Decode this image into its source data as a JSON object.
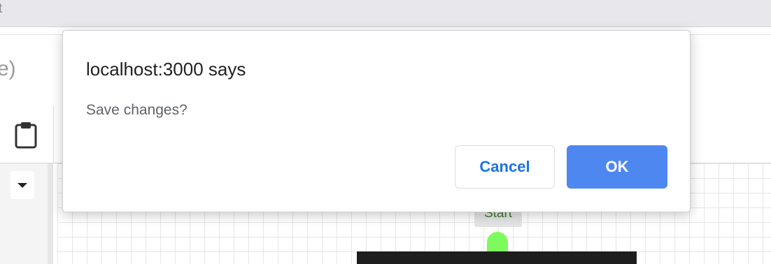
{
  "browser": {
    "tab_fragment": "t"
  },
  "app": {
    "title_fragment": "e)"
  },
  "toolbar": {
    "clipboard_icon": "clipboard-icon"
  },
  "left_panel": {
    "dropdown_icon": "chevron-down-icon"
  },
  "canvas": {
    "start_label": "Start",
    "start_color": "#7dfb5c"
  },
  "dialog": {
    "title": "localhost:3000 says",
    "message": "Save changes?",
    "cancel_label": "Cancel",
    "ok_label": "OK",
    "accent_color": "#4f87f0"
  }
}
